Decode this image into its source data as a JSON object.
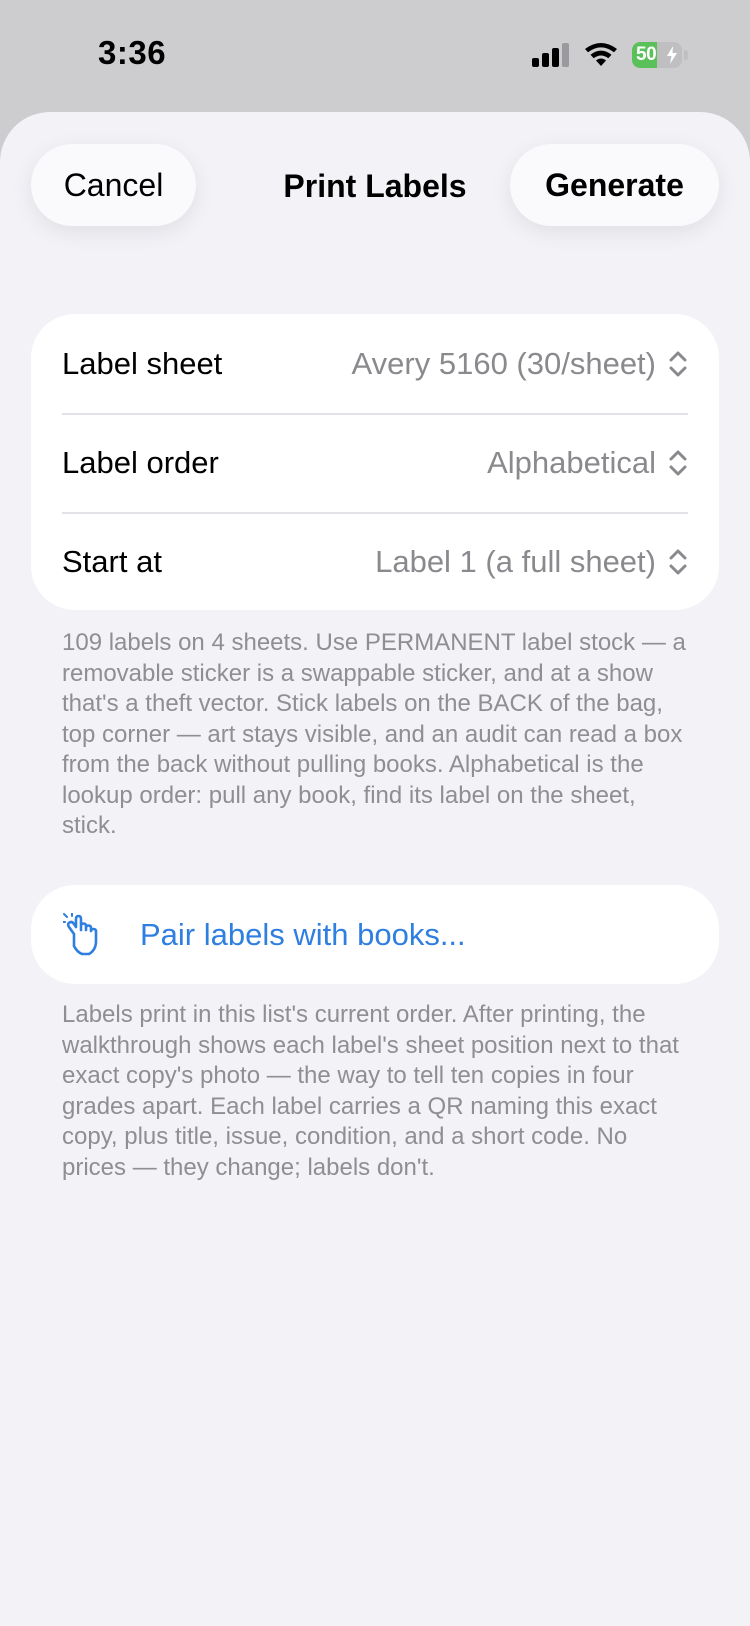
{
  "status_bar": {
    "time": "3:36",
    "battery_level": "50",
    "battery_fraction": 0.5,
    "icons": [
      "signal-icon",
      "wifi-icon",
      "battery-icon"
    ]
  },
  "nav": {
    "cancel_label": "Cancel",
    "title": "Print Labels",
    "generate_label": "Generate"
  },
  "settings": {
    "rows": [
      {
        "label": "Label sheet",
        "value": "Avery 5160 (30/sheet)"
      },
      {
        "label": "Label order",
        "value": "Alphabetical"
      },
      {
        "label": "Start at",
        "value": "Label 1 (a full sheet)"
      }
    ]
  },
  "settings_footnote": "109 labels on 4 sheets. Use PERMANENT label stock — a removable sticker is a swappable sticker, and at a show that's a theft vector. Stick labels on the BACK of the bag, top corner — art stays visible, and an audit can read a box from the back without pulling books. Alphabetical is the lookup order: pull any book, find its label on the sheet, stick.",
  "pair_action": {
    "icon": "hand-point-icon",
    "label": "Pair labels with books..."
  },
  "pair_footnote": "Labels print in this list's current order. After printing, the walkthrough shows each label's sheet position next to that exact copy's photo — the way to tell ten copies in four grades apart. Each label carries a QR naming this exact copy, plus title, issue, condition, and a short code. No prices — they change; labels don't.",
  "colors": {
    "accent": "#2f7fe0",
    "secondary_text": "#8a8a8e",
    "sheet_background": "#f2f2f7",
    "battery_green": "#5ac15a"
  }
}
